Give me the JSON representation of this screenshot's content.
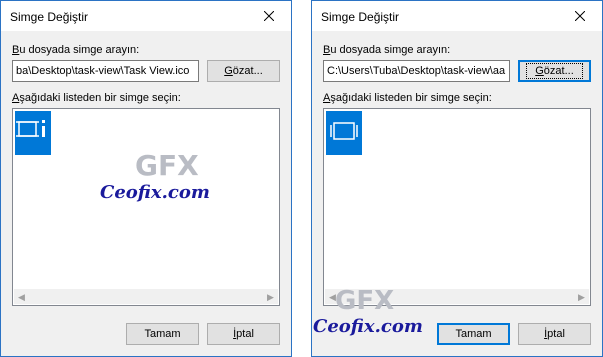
{
  "dialogs": [
    {
      "title": "Simge Değiştir",
      "file_label_prefix": "B",
      "file_label_rest": "u dosyada simge arayın:",
      "file_value": "ba\\Desktop\\task-view\\Task View.ico",
      "browse_prefix": "G",
      "browse_rest": "özat...",
      "list_label_prefix": "A",
      "list_label_rest": "şağıdaki listeden bir simge seçin:",
      "ok_label": "Tamam",
      "cancel_prefix": "İ",
      "cancel_rest": "ptal"
    },
    {
      "title": "Simge Değiştir",
      "file_label_prefix": "B",
      "file_label_rest": "u dosyada simge arayın:",
      "file_value": "C:\\Users\\Tuba\\Desktop\\task-view\\aa",
      "browse_prefix": "G",
      "browse_rest": "özat...",
      "list_label_prefix": "A",
      "list_label_rest": "şağıdaki listeden bir simge seçin:",
      "ok_label": "Tamam",
      "cancel_prefix": "İ",
      "cancel_rest": "ptal"
    }
  ],
  "watermark": {
    "logo": "GFX",
    "text": "Ceofix.com"
  },
  "colors": {
    "accent": "#0078d7",
    "frame": "#2b73c4",
    "watermark_text": "#1a1a9c",
    "watermark_logo": "#b9bcc4"
  },
  "icons": {
    "close": "close-icon",
    "left_selected": "task-view-icon",
    "right_selected": "task-view-icon"
  }
}
